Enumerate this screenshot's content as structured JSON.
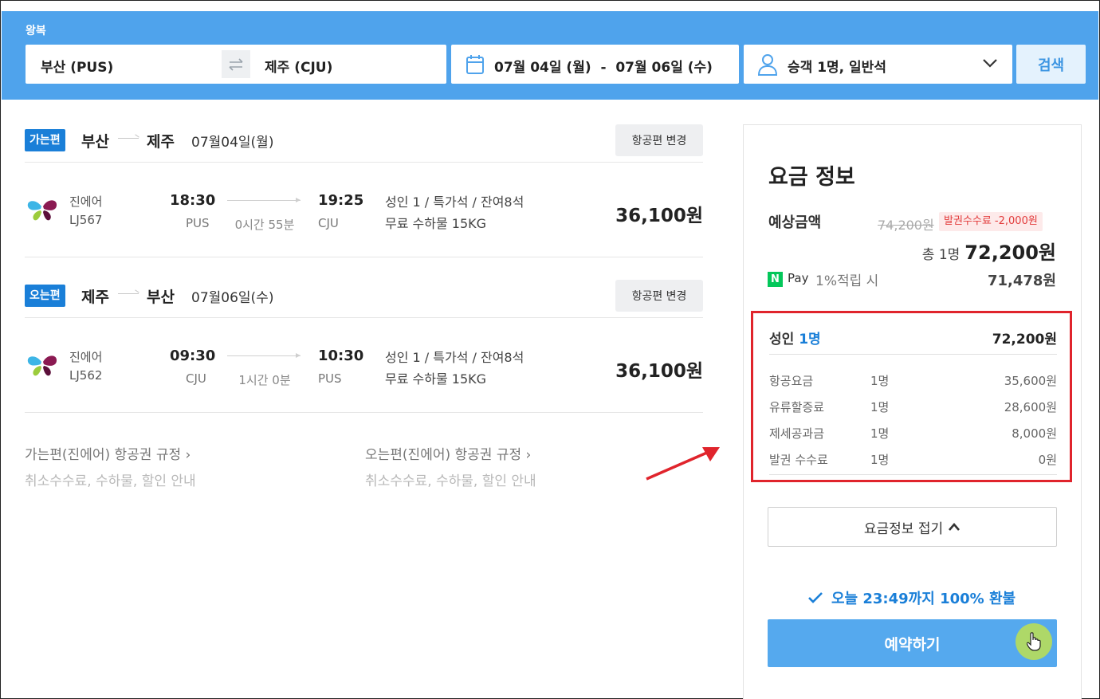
{
  "search": {
    "trip_type": "왕복",
    "from": "부산 (PUS)",
    "to": "제주 (CJU)",
    "dates": "07월 04일 (월)  -  07월 06일 (수)",
    "passengers": "승객 1명, 일반석",
    "search_button": "검색"
  },
  "segments": [
    {
      "badge": "가는편",
      "from_city": "부산",
      "to_city": "제주",
      "date": "07월04일(월)",
      "change_button": "항공편 변경",
      "airline": "진에어",
      "flight_no": "LJ567",
      "dep_time": "18:30",
      "dep_code": "PUS",
      "duration": "0시간 55분",
      "arr_time": "19:25",
      "arr_code": "CJU",
      "seat_info": "성인 1 / 특가석 / 잔여8석",
      "baggage": "무료 수하물 15KG",
      "price": "36,100원"
    },
    {
      "badge": "오는편",
      "from_city": "제주",
      "to_city": "부산",
      "date": "07월06일(수)",
      "change_button": "항공편 변경",
      "airline": "진에어",
      "flight_no": "LJ562",
      "dep_time": "09:30",
      "dep_code": "CJU",
      "duration": "1시간 0분",
      "arr_time": "10:30",
      "arr_code": "PUS",
      "seat_info": "성인 1 / 특가석 / 잔여8석",
      "baggage": "무료 수하물 15KG",
      "price": "36,100원"
    }
  ],
  "rules": [
    {
      "title": "가는편(진에어) 항공권 규정  ›",
      "subtitle": "취소수수료, 수하물, 할인 안내"
    },
    {
      "title": "오는편(진에어) 항공권 규정  ›",
      "subtitle": "취소수수료, 수하물, 할인 안내"
    }
  ],
  "fare": {
    "title": "요금 정보",
    "estimate_label": "예상금액",
    "original_price": "74,200원",
    "discount_badge": "발권수수료 -2,000원",
    "total_prefix": "총 1명",
    "total_price": "72,200원",
    "npay_icon": "N",
    "npay_label": "Pay",
    "npay_benefit": "1%적립 시",
    "npay_price": "71,478원",
    "breakdown": {
      "adult_label": "성인",
      "adult_count": "1명",
      "adult_total": "72,200원",
      "rows": [
        {
          "name": "항공요금",
          "count": "1명",
          "amount": "35,600원"
        },
        {
          "name": "유류할증료",
          "count": "1명",
          "amount": "28,600원"
        },
        {
          "name": "제세공과금",
          "count": "1명",
          "amount": "8,000원"
        },
        {
          "name": "발권 수수료",
          "count": "1명",
          "amount": "0원"
        }
      ]
    },
    "collapse_button": "요금정보 접기",
    "refund_note": "오늘 23:49까지 100% 환불",
    "book_button": "예약하기"
  },
  "colors": {
    "header_blue": "#4fa3ec",
    "badge_blue": "#1a7fd8",
    "highlight_red": "#e0242c",
    "book_button": "#55a9ee",
    "npay_green": "#03c75a"
  },
  "icons": [
    "swap-icon",
    "calendar-icon",
    "user-icon",
    "chevron-down-icon",
    "airline-butterfly-logo",
    "chevron-up-icon",
    "check-icon",
    "hand-cursor-icon",
    "red-arrow-annotation"
  ]
}
